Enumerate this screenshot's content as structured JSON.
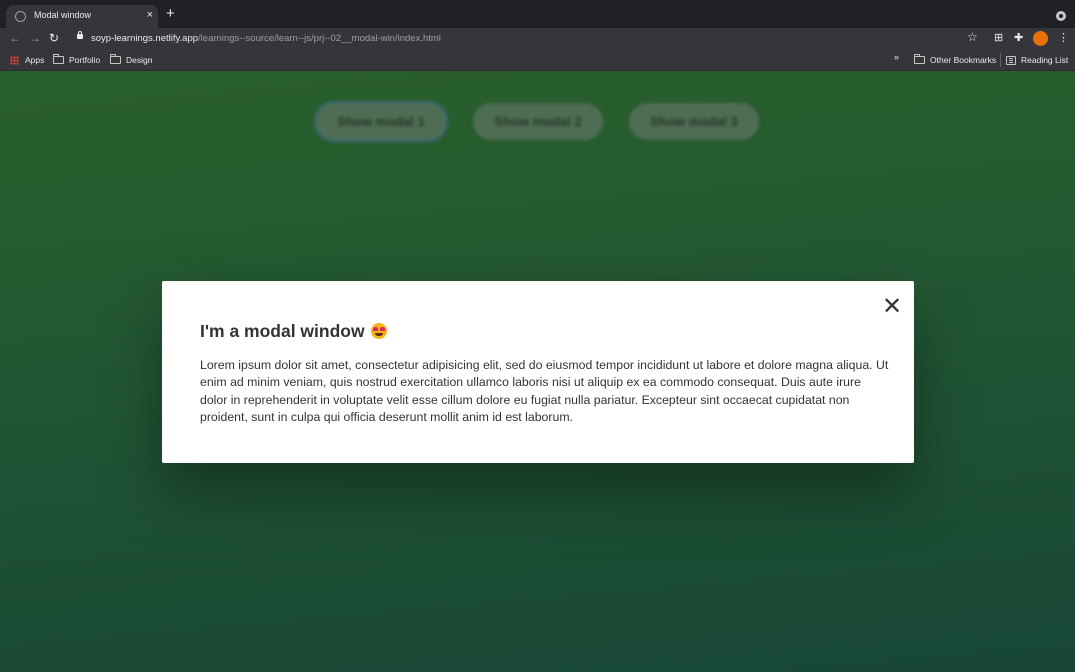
{
  "browser": {
    "tab_title": "Modal window",
    "tab_close_glyph": "×",
    "new_tab_glyph": "+",
    "back_glyph": "←",
    "forward_glyph": "→",
    "reload_glyph": "↻",
    "url_host": "soyp-learnings.netlify.app",
    "url_path": "/learnings--source/learn--js/prj--02__modal-win/index.html",
    "star_glyph": "☆",
    "menu_glyph": "⋮",
    "profile_color": "#e8710a"
  },
  "bookmarks": {
    "apps": "Apps",
    "portfolio": "Portfolio",
    "design": "Design",
    "more_glyph": "»",
    "other": "Other Bookmarks",
    "reading_list": "Reading List"
  },
  "page": {
    "buttons": [
      {
        "label": "Show modal 1"
      },
      {
        "label": "Show modal 2"
      },
      {
        "label": "Show modal 3"
      }
    ],
    "modal": {
      "title": "I'm a modal window",
      "close_glyph": "✕",
      "body": "Lorem ipsum dolor sit amet, consectetur adipisicing elit, sed do eiusmod tempor incididunt ut labore et dolore magna aliqua. Ut enim ad minim veniam, quis nostrud exercitation ullamco laboris nisi ut aliquip ex ea commodo consequat. Duis aute irure dolor in reprehenderit in voluptate velit esse cillum dolore eu fugiat nulla pariatur. Excepteur sint occaecat cupidatat non proident, sunt in culpa qui officia deserunt mollit anim id est laborum."
    }
  }
}
